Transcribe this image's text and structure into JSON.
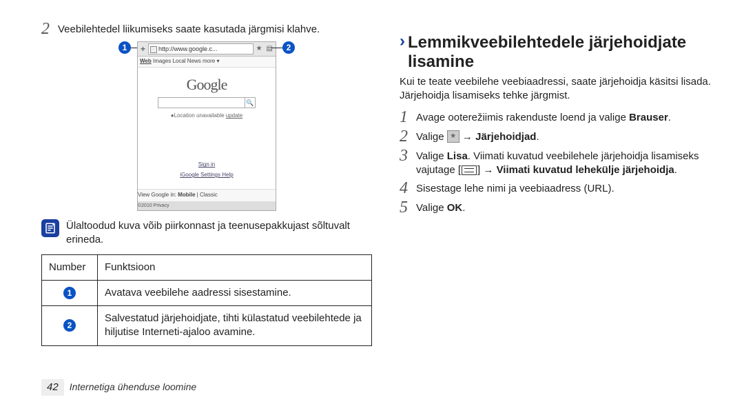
{
  "left": {
    "step2_text": "Veebilehtedel liikumiseks saate kasutada järgmisi klahve.",
    "callout1": "1",
    "callout2": "2",
    "browser": {
      "url_text": "http://www.google.c...",
      "tabs": "Web  Images  Local  News  more ▾",
      "tabs_web": "Web",
      "logo": "Google",
      "loc_line": "●Location unavailable  update",
      "loc_update": "update",
      "signin": "Sign in",
      "footer_links": "iGoogle   Settings   Help",
      "view_line": "View Google in: Mobile | Classic",
      "view_classic": "Classic",
      "view_mobile": "Mobile",
      "copyright": "©2010  Privacy"
    },
    "note_text": "Ülaltoodud kuva võib piirkonnast ja teenusepakkujast sõltuvalt erineda.",
    "table": {
      "col1": "Number",
      "col2": "Funktsioon",
      "row1": {
        "n": "1",
        "desc": "Avatava veebilehe aadressi sisestamine."
      },
      "row2": {
        "n": "2",
        "desc": "Salvestatud järjehoidjate, tihti külastatud veebilehtede ja hiljutise Interneti-ajaloo avamine."
      }
    }
  },
  "right": {
    "heading": "Lemmikveebilehtedele järjehoidjate lisamine",
    "intro": "Kui te teate veebilehe veebiaadressi, saate järjehoidja käsitsi lisada. Järjehoidja lisamiseks tehke järgmist.",
    "step1_pre": "Avage ooterežiimis rakenduste loend ja valige ",
    "step1_bold": "Brauser",
    "step1_suffix": ".",
    "step2_pre": "Valige ",
    "step2_arrow": " → ",
    "step2_bold": "Järjehoidjad",
    "step2_suffix": ".",
    "step3_pre": "Valige ",
    "step3_b1": "Lisa",
    "step3_mid": ". Viimati kuvatud veebilehele järjehoidja lisamiseks vajutage [",
    "step3_arrow": "] → ",
    "step3_b2": "Viimati kuvatud lehekülje järjehoidja",
    "step3_suffix": ".",
    "step4": "Sisestage lehe nimi ja veebiaadress (URL).",
    "step5_pre": "Valige ",
    "step5_bold": "OK",
    "step5_suffix": "."
  },
  "footer": {
    "page": "42",
    "section": "Internetiga ühenduse loomine"
  },
  "icons": {
    "note": "note-icon",
    "bookmark": "bookmark-icon",
    "menu": "menu-icon",
    "search": "search-icon"
  }
}
